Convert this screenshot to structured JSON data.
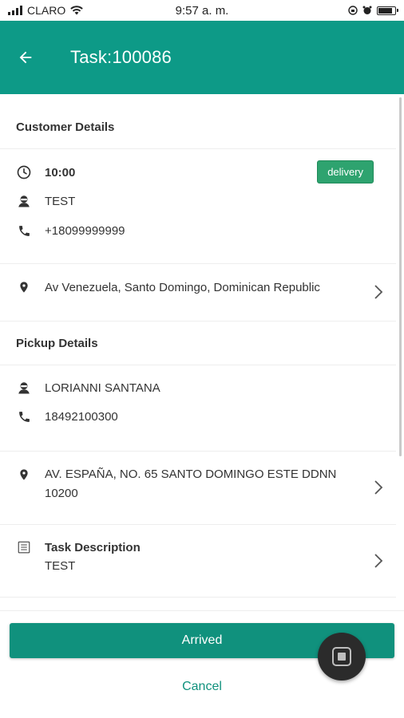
{
  "status_bar": {
    "carrier": "CLARO",
    "time": "9:57 a. m."
  },
  "header": {
    "title": "Task:100086",
    "back_icon": "arrow-left-icon"
  },
  "customer": {
    "section_title": "Customer Details",
    "time": "10:00",
    "badge": "delivery",
    "name": "TEST",
    "phone": "+18099999999",
    "address": "Av Venezuela, Santo Domingo, Dominican Republic"
  },
  "pickup": {
    "section_title": "Pickup Details",
    "name": "LORIANNI SANTANA",
    "phone": "18492100300",
    "address_line1": "AV. ESPAÑA, NO. 65 SANTO DOMINGO ESTE DDNN",
    "address_line2": "10200"
  },
  "task": {
    "label": "Task Description",
    "value": "TEST"
  },
  "actions": {
    "arrived": "Arrived",
    "cancel": "Cancel"
  },
  "colors": {
    "primary": "#0d9a87",
    "badge": "#2ea36f"
  }
}
